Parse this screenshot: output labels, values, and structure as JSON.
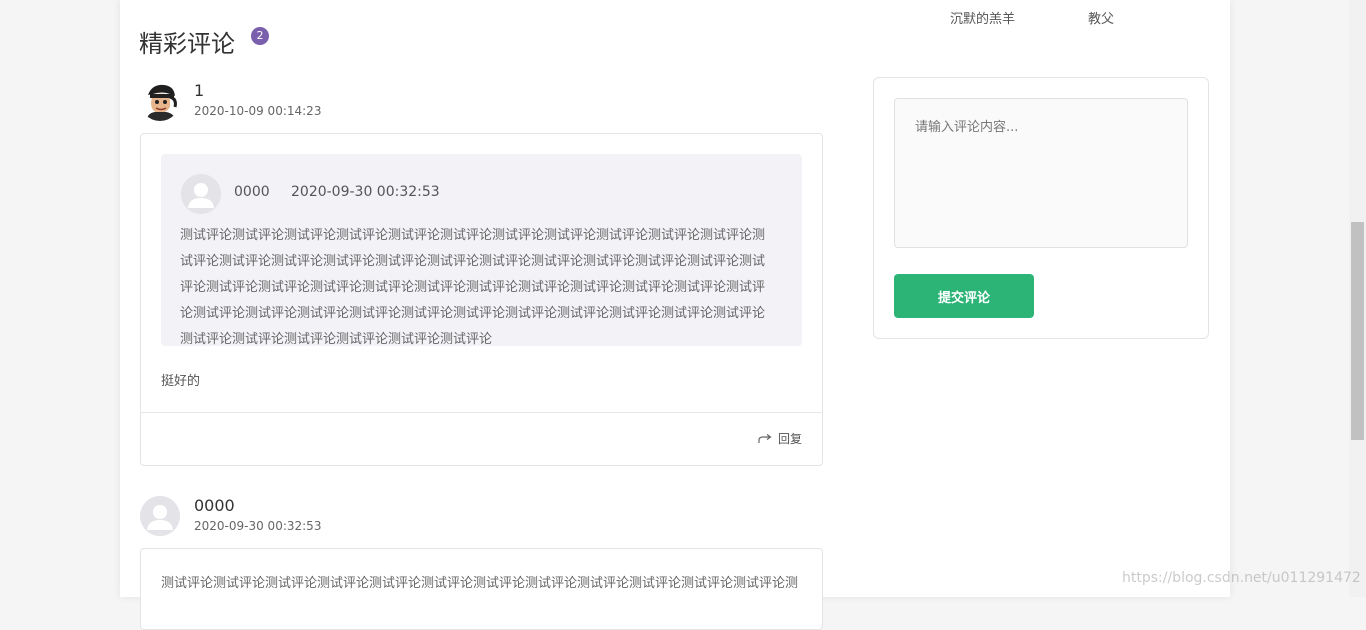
{
  "header": {
    "top_links": [
      "沉默的羔羊",
      "教父"
    ]
  },
  "section": {
    "title": "精彩评论",
    "count": "2"
  },
  "comments": [
    {
      "user": "1",
      "date": "2020-10-09 00:14:23",
      "avatar_icon": "cartoon-avatar-icon",
      "quoted": {
        "user": "0000",
        "date": "2020-09-30 00:32:53",
        "text": "测试评论测试评论测试评论测试评论测试评论测试评论测试评论测试评论测试评论测试评论测试评论测试评论测试评论测试评论测试评论测试评论测试评论测试评论测试评论测试评论测试评论测试评论测试评论测试评论测试评论测试评论测试评论测试评论测试评论测试评论测试评论测试评论测试评论测试评论测试评论测试评论测试评论测试评论测试评论测试评论测试评论测试评论测试评论测试评论测试评论测试评论测试评论测试评论测试评论测试评论测试评论"
      },
      "text": "挺好的",
      "reply_label": "回复"
    },
    {
      "user": "0000",
      "date": "2020-09-30 00:32:53",
      "avatar_icon": "default-user-icon",
      "text": "测试评论测试评论测试评论测试评论测试评论测试评论测试评论测试评论测试评论测试评论测试评论测试评论测"
    }
  ],
  "form": {
    "placeholder": "请输入评论内容...",
    "submit_label": "提交评论"
  },
  "watermark": "https://blog.csdn.net/u011291472",
  "colors": {
    "accent": "#2cb477",
    "badge": "#7b5fad",
    "quote_bg": "#f3f2f7"
  }
}
